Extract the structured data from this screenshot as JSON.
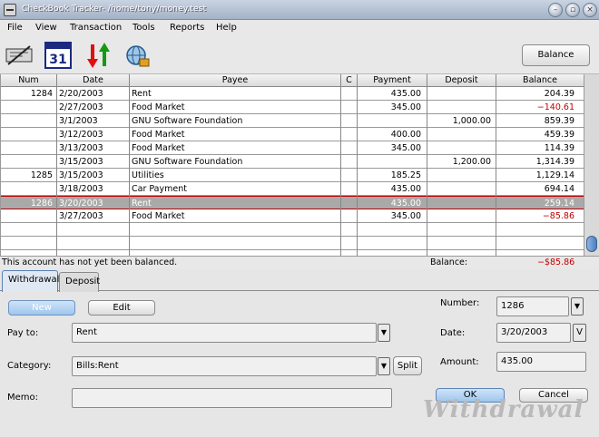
{
  "window": {
    "title": "CheckBook Tracker- /home/tony/money.test"
  },
  "menu": {
    "file": "File",
    "view": "View",
    "transaction": "Transaction",
    "tools": "Tools",
    "reports": "Reports",
    "help": "Help"
  },
  "toolbar": {
    "balance_label": "Balance",
    "icons": [
      "checkbook-icon",
      "calendar-icon",
      "transfer-arrows-icon",
      "globe-icon"
    ],
    "calendar_day": "31"
  },
  "register": {
    "columns": [
      "Num",
      "Date",
      "Payee",
      "C",
      "Payment",
      "Deposit",
      "Balance"
    ],
    "rows": [
      {
        "num": "1284",
        "date": "2/20/2003",
        "payee": "Rent",
        "c": "",
        "payment": "435.00",
        "deposit": "",
        "balance": "204.39",
        "negative": false
      },
      {
        "num": "",
        "date": "2/27/2003",
        "payee": "Food Market",
        "c": "",
        "payment": "345.00",
        "deposit": "",
        "balance": "−140.61",
        "negative": true
      },
      {
        "num": "",
        "date": "3/1/2003",
        "payee": "GNU Software Foundation",
        "c": "",
        "payment": "",
        "deposit": "1,000.00",
        "balance": "859.39",
        "negative": false
      },
      {
        "num": "",
        "date": "3/12/2003",
        "payee": "Food Market",
        "c": "",
        "payment": "400.00",
        "deposit": "",
        "balance": "459.39",
        "negative": false
      },
      {
        "num": "",
        "date": "3/13/2003",
        "payee": "Food Market",
        "c": "",
        "payment": "345.00",
        "deposit": "",
        "balance": "114.39",
        "negative": false
      },
      {
        "num": "",
        "date": "3/15/2003",
        "payee": "GNU Software Foundation",
        "c": "",
        "payment": "",
        "deposit": "1,200.00",
        "balance": "1,314.39",
        "negative": false
      },
      {
        "num": "1285",
        "date": "3/15/2003",
        "payee": "Utilities",
        "c": "",
        "payment": "185.25",
        "deposit": "",
        "balance": "1,129.14",
        "negative": false
      },
      {
        "num": "",
        "date": "3/18/2003",
        "payee": "Car Payment",
        "c": "",
        "payment": "435.00",
        "deposit": "",
        "balance": "694.14",
        "negative": false
      },
      {
        "num": "1286",
        "date": "3/20/2003",
        "payee": "Rent",
        "c": "",
        "payment": "435.00",
        "deposit": "",
        "balance": "259.14",
        "negative": false,
        "selected": true
      },
      {
        "num": "",
        "date": "3/27/2003",
        "payee": "Food Market",
        "c": "",
        "payment": "345.00",
        "deposit": "",
        "balance": "−85.86",
        "negative": true
      }
    ]
  },
  "status": {
    "message": "This account has not yet been balanced.",
    "balance_label": "Balance:",
    "balance_value": "−$85.86"
  },
  "tabs": {
    "withdrawal": "Withdrawal",
    "deposit": "Deposit"
  },
  "form": {
    "new_label": "New",
    "edit_label": "Edit",
    "pay_to_label": "Pay to:",
    "pay_to_value": "Rent",
    "category_label": "Category:",
    "category_value": "Bills:Rent",
    "split_label": "Split",
    "memo_label": "Memo:",
    "memo_value": "",
    "number_label": "Number:",
    "number_value": "1286",
    "date_label": "Date:",
    "date_value": "3/20/2003",
    "date_button": "V",
    "amount_label": "Amount:",
    "amount_value": "435.00",
    "ok_label": "OK",
    "cancel_label": "Cancel",
    "watermark": "Withdrawal"
  },
  "colors": {
    "negative": "#c00000",
    "selected_row": "#a9a9a9",
    "accent_button": "#9ec6ee"
  }
}
